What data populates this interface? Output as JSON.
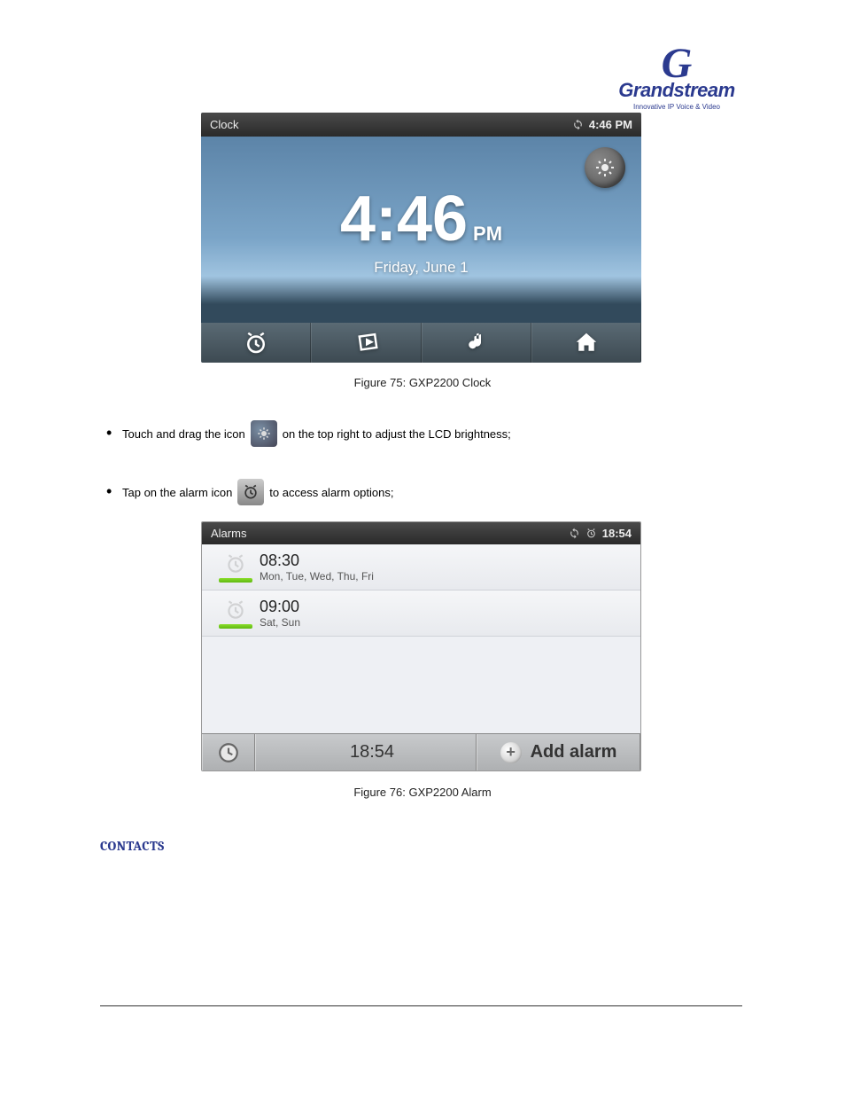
{
  "logo": {
    "brand": "Grandstream",
    "tagline": "Innovative IP Voice & Video",
    "initial": "G"
  },
  "clock_shot": {
    "topbar_title": "Clock",
    "status_time": "4:46 PM",
    "main_time": "4:46",
    "ampm": "PM",
    "date": "Friday, June 1"
  },
  "caption1": "Figure 75: GXP2200 Clock",
  "bullets": {
    "b1a": "Touch and drag the icon",
    "b1b": "on the top right to adjust the LCD brightness;",
    "b2a": "Tap on the alarm icon",
    "b2b": "to access alarm options;"
  },
  "alarm_shot": {
    "topbar_title": "Alarms",
    "status_time": "18:54",
    "rows": [
      {
        "time": "08:30",
        "days": "Mon, Tue, Wed, Thu, Fri"
      },
      {
        "time": "09:00",
        "days": "Sat, Sun"
      }
    ],
    "bottom_time": "18:54",
    "add_label": "Add alarm"
  },
  "caption2": "Figure 76: GXP2200 Alarm",
  "contacts_heading": "CONTACTS"
}
